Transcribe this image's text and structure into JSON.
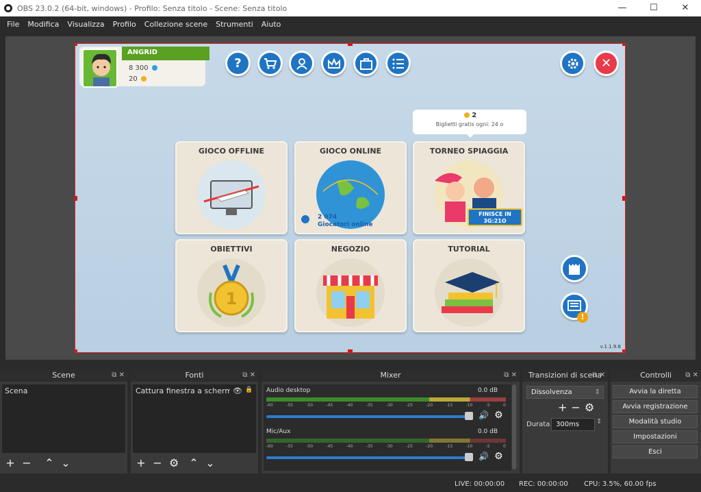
{
  "window": {
    "title": "OBS 23.0.2 (64-bit, windows) - Profilo: Senza titolo - Scene: Senza titolo",
    "minimize": "—",
    "maximize": "☐",
    "close": "✕"
  },
  "menu": [
    "File",
    "Modifica",
    "Visualizza",
    "Profilo",
    "Collezione scene",
    "Strumenti",
    "Aiuto"
  ],
  "game": {
    "player_name": "ANGRID",
    "coins": "8 300",
    "tokens": "20",
    "tooltip_count": "2",
    "tooltip_text": "Biglietti gratis ogni: 24 o",
    "tiles": [
      {
        "label": "GIOCO OFFLINE"
      },
      {
        "label": "GIOCO ONLINE",
        "players_count": "2 074",
        "players_label": "Giocatori online"
      },
      {
        "label": "TORNEO SPIAGGIA",
        "ends_label": "FINISCE IN",
        "ends_time": "3G:21O"
      },
      {
        "label": "OBIETTIVI"
      },
      {
        "label": "NEGOZIO"
      },
      {
        "label": "TUTORIAL"
      }
    ],
    "version": "v.1.1.9.8",
    "colors": {
      "accent_blue": "#1f74c4",
      "close_red": "#e83a4a",
      "banner_green": "#5aa021"
    }
  },
  "docks": {
    "scenes": {
      "title": "Scene",
      "items": [
        "Scena"
      ]
    },
    "sources": {
      "title": "Fonti",
      "items": [
        "Cattura finestra a schermo inte"
      ]
    },
    "mixer": {
      "title": "Mixer",
      "channels": [
        {
          "name": "Audio desktop",
          "level": "0.0 dB"
        },
        {
          "name": "Mic/Aux",
          "level": "0.0 dB"
        }
      ],
      "ticks": [
        "-60",
        "-55",
        "-50",
        "-45",
        "-40",
        "-35",
        "-30",
        "-25",
        "-20",
        "-15",
        "-10",
        "-5",
        "0"
      ]
    },
    "transitions": {
      "title": "Transizioni di scena",
      "selected": "Dissolvenza",
      "duration_label": "Durata",
      "duration_value": "300ms"
    },
    "controls": {
      "title": "Controlli",
      "buttons": [
        "Avvia la diretta",
        "Avvia registrazione",
        "Modalità studio",
        "Impostazioni",
        "Esci"
      ]
    }
  },
  "status": {
    "live": "LIVE: 00:00:00",
    "rec": "REC: 00:00:00",
    "cpu": "CPU: 3.5%, 60.00 fps"
  }
}
